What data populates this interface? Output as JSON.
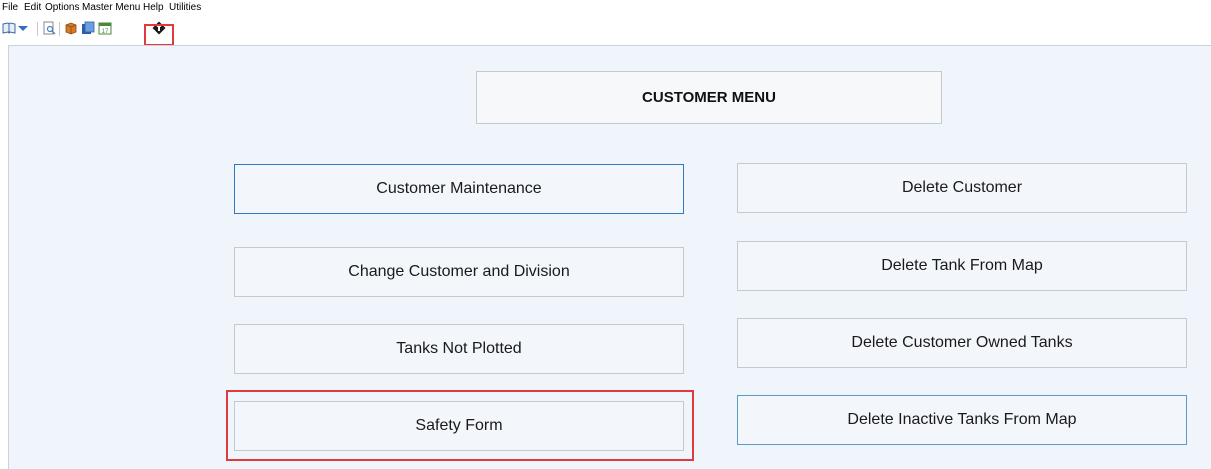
{
  "menubar": {
    "items": [
      {
        "label": "File"
      },
      {
        "label": "Edit"
      },
      {
        "label": "Options"
      },
      {
        "label": "Master Menu"
      },
      {
        "label": "Help"
      },
      {
        "label": "Utilities"
      }
    ]
  },
  "toolbar": {
    "icons": [
      "book-icon",
      "dropdown-arrow-icon",
      "search-document-icon",
      "box-icon",
      "reports-icon",
      "calendar-icon",
      "direction-sign-icon"
    ],
    "calendar_text": "17"
  },
  "main": {
    "title": "CUSTOMER MENU",
    "buttons_left": [
      {
        "label": "Customer Maintenance"
      },
      {
        "label": "Change Customer and Division"
      },
      {
        "label": "Tanks Not Plotted"
      },
      {
        "label": "Safety Form"
      }
    ],
    "buttons_right": [
      {
        "label": "Delete Customer"
      },
      {
        "label": "Delete Tank From Map"
      },
      {
        "label": "Delete Customer Owned Tanks"
      },
      {
        "label": "Delete Inactive Tanks From Map"
      }
    ]
  },
  "colors": {
    "panel_bg": "#f0f4fb",
    "button_bg": "#f3f6fb",
    "focus_border": "#2f78c4",
    "highlight": "#e0393e"
  }
}
